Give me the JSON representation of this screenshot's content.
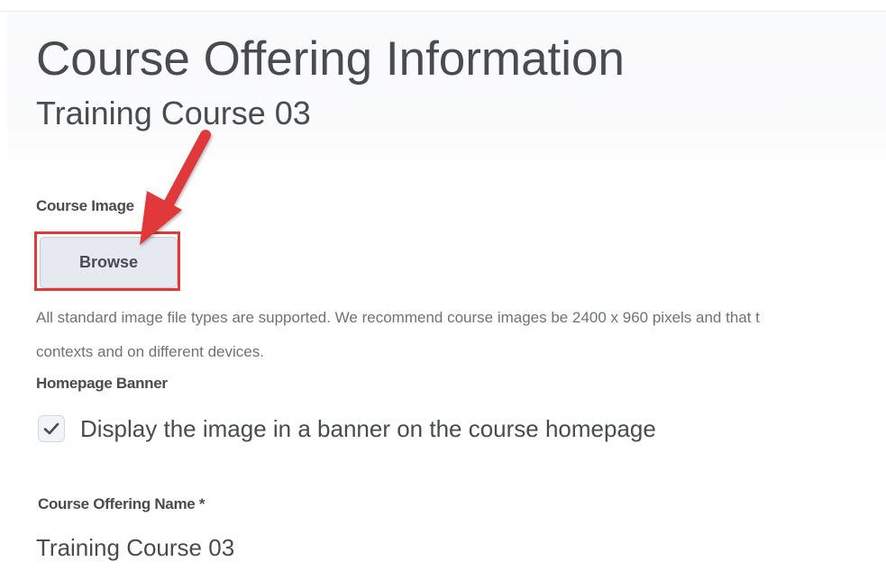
{
  "header": {
    "title": "Course Offering Information",
    "subtitle": "Training Course 03"
  },
  "course_image": {
    "label": "Course Image",
    "browse_label": "Browse",
    "help_text_line1": "All standard image file types are supported. We recommend course images be 2400 x 960 pixels and that t",
    "help_text_line2": "contexts and on different devices."
  },
  "homepage_banner": {
    "label": "Homepage Banner",
    "checkbox_label": "Display the image in a banner on the course homepage",
    "checked": true
  },
  "course_offering_name": {
    "label": "Course Offering Name *",
    "value": "Training Course 03"
  },
  "colors": {
    "annotation": "#e0393a",
    "text": "#494c4e",
    "muted_text": "#6e7376",
    "button_bg": "#e6e9f0"
  },
  "icons": {
    "checkbox": "checkmark-icon",
    "annotation": "red-arrow-icon"
  }
}
